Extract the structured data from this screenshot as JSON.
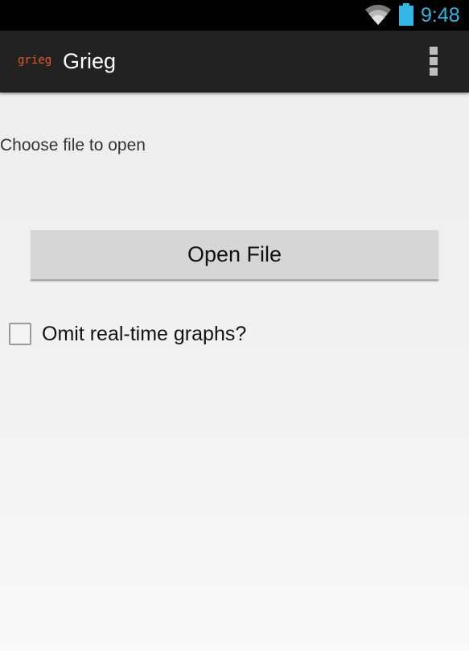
{
  "status_bar": {
    "time": "9:48",
    "icons": [
      "wifi-icon",
      "battery-icon"
    ],
    "accent_color": "#33b5e5"
  },
  "action_bar": {
    "logo_text": "grieg",
    "title": "Grieg",
    "overflow_icon": "overflow-menu-icon",
    "logo_color": "#e8562a"
  },
  "main": {
    "prompt": "Choose file to open",
    "open_button_label": "Open File",
    "omit_checkbox": {
      "label": "Omit real-time graphs?",
      "checked": false
    }
  }
}
